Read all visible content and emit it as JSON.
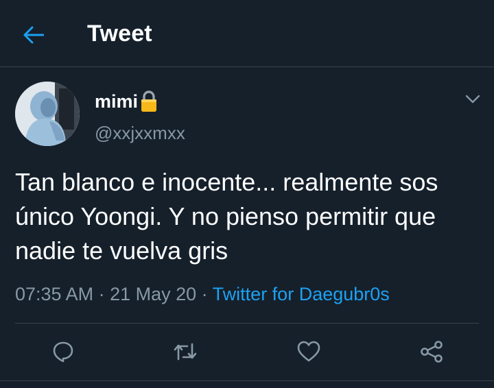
{
  "header": {
    "title": "Tweet",
    "back_icon": "arrow-left-icon"
  },
  "author": {
    "display_name": "mimi",
    "lock_icon": "lock-icon",
    "handle": "@xxjxxmxx"
  },
  "tweet": {
    "text": "Tan blanco e inocente... realmente sos único Yoongi. Y no pienso permitir que nadie te vuelva gris",
    "time": "07:35 AM",
    "separator": " · ",
    "date": "21 May 20",
    "source": "Twitter for Daegubr0s"
  },
  "actions": [
    {
      "name": "reply",
      "icon": "reply-icon"
    },
    {
      "name": "retweet",
      "icon": "retweet-icon"
    },
    {
      "name": "like",
      "icon": "heart-icon"
    },
    {
      "name": "share",
      "icon": "share-icon"
    }
  ],
  "colors": {
    "background": "#15202b",
    "accent": "#1da1f2",
    "secondary_text": "#8899a6",
    "divider": "#38444d"
  }
}
